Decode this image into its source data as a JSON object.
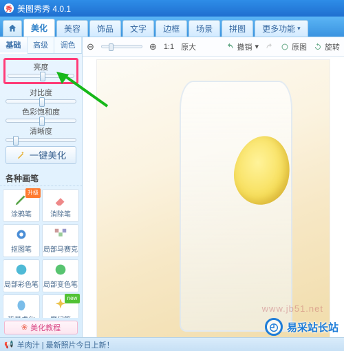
{
  "app": {
    "title": "美图秀秀 4.0.1"
  },
  "tabs": {
    "items": [
      "美化",
      "美容",
      "饰品",
      "文字",
      "边框",
      "场景",
      "拼图"
    ],
    "more": "更多功能",
    "activeIndex": 0
  },
  "subtabs": {
    "items": [
      "基础",
      "高级",
      "调色"
    ],
    "activeIndex": 0
  },
  "sliders": {
    "brightness": "亮度",
    "contrast": "对比度",
    "saturation": "色彩饱和度",
    "sharpness": "清晰度"
  },
  "one_key_label": "一键美化",
  "brush_header": "各种画笔",
  "brushes": [
    {
      "label": "涂鸦笔",
      "badge": "升级",
      "badgeType": "up"
    },
    {
      "label": "消除笔",
      "badge": "",
      "badgeType": ""
    },
    {
      "label": "抠图笔",
      "badge": "",
      "badgeType": ""
    },
    {
      "label": "局部马赛克",
      "badge": "",
      "badgeType": ""
    },
    {
      "label": "局部彩色笔",
      "badge": "",
      "badgeType": ""
    },
    {
      "label": "局部变色笔",
      "badge": "",
      "badgeType": ""
    },
    {
      "label": "背景虚化",
      "badge": "",
      "badgeType": ""
    },
    {
      "label": "魔幻笔",
      "badge": "new",
      "badgeType": "new"
    }
  ],
  "tutorial_label": "美化教程",
  "toolbar": {
    "zoom_ratio": "1:1",
    "zoom_label": "原大",
    "undo": "撤销",
    "redo": "",
    "original": "原图",
    "rotate": "旋转"
  },
  "footer": {
    "text": "羊肉汁 | 最新照片今日上新！"
  },
  "watermark": {
    "text": "易采站长站"
  },
  "urlmark": "www.jb51.net"
}
